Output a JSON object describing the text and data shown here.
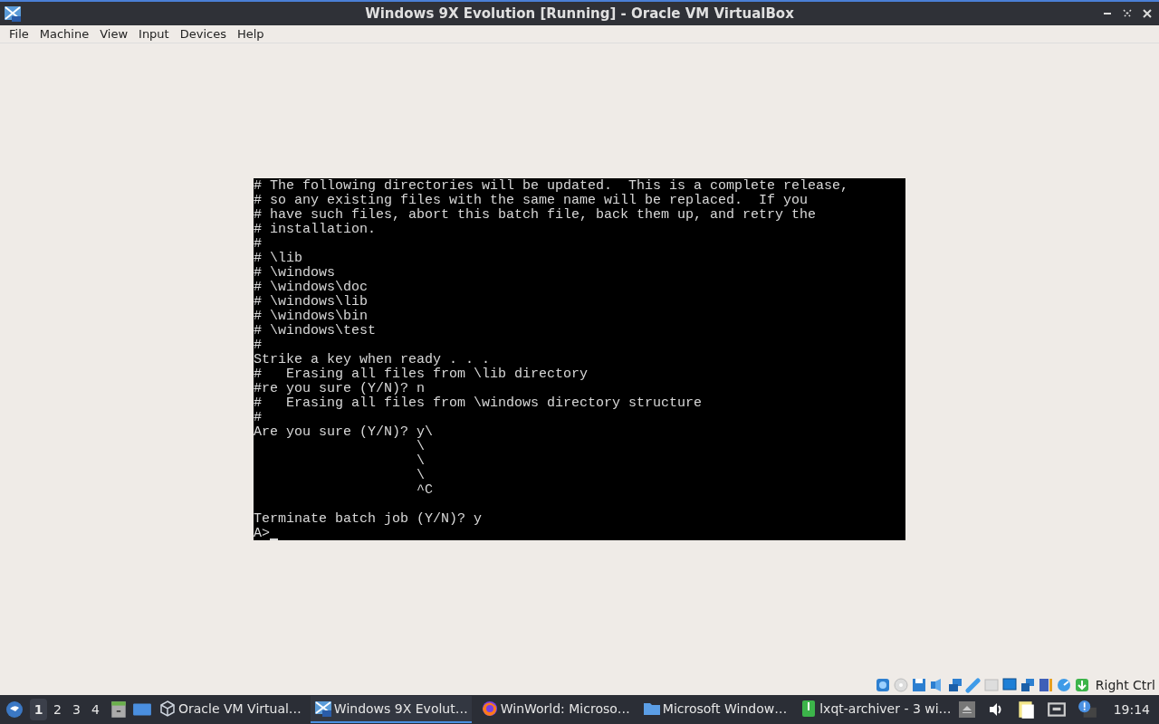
{
  "window": {
    "title": "Windows 9X Evolution [Running] - Oracle VM VirtualBox"
  },
  "menu": [
    "File",
    "Machine",
    "View",
    "Input",
    "Devices",
    "Help"
  ],
  "console": {
    "lines": [
      {
        "text": "# The following directories will be updated.  This is a complete release,"
      },
      {
        "text": "# so any existing files with the same name will be replaced.  If you"
      },
      {
        "text": "# have such files, abort this batch file, back them up, and retry the"
      },
      {
        "text": "# installation."
      },
      {
        "text": "#"
      },
      {
        "text": "# \\lib"
      },
      {
        "text": "# \\windows"
      },
      {
        "text": "# \\windows\\doc"
      },
      {
        "text": "# \\windows\\lib"
      },
      {
        "text": "# \\windows\\bin"
      },
      {
        "text": "# \\windows\\test"
      },
      {
        "text": "#"
      },
      {
        "text": "Strike a key when ready . . ."
      },
      {
        "text": "#   Erasing all files from \\lib directory"
      },
      {
        "text": "#re you sure (Y/N)? n"
      },
      {
        "text": "#   Erasing all files from \\windows directory structure"
      },
      {
        "text": "#"
      },
      {
        "text": "Are you sure (Y/N)? y\\"
      },
      {
        "text": "                    \\"
      },
      {
        "text": "                    \\"
      },
      {
        "text": "                    \\"
      },
      {
        "text": "                    ^C"
      }
    ],
    "after_blank_line": [
      {
        "text": "Terminate batch job (Y/N)? y"
      }
    ],
    "prompt": {
      "text": "A>",
      "cursor": true
    }
  },
  "status_bar": {
    "host_key": "Right Ctrl"
  },
  "taskbar": {
    "workspaces": [
      {
        "label": "1",
        "selected": true
      },
      {
        "label": "2",
        "selected": false
      },
      {
        "label": "3",
        "selected": false
      },
      {
        "label": "4",
        "selected": false
      }
    ],
    "tasks": [
      {
        "kind": "vbox",
        "label": "Oracle VM Virtual…",
        "selected": false
      },
      {
        "kind": "vm",
        "label": "Windows 9X Evolut…",
        "selected": true
      },
      {
        "kind": "browser",
        "label": "WinWorld: Microso…",
        "selected": false
      },
      {
        "kind": "folder",
        "label": "Microsoft Window…",
        "selected": false
      },
      {
        "kind": "archive",
        "label": "lxqt-archiver - 3 wi…",
        "selected": false
      }
    ],
    "clock": "19:14"
  }
}
